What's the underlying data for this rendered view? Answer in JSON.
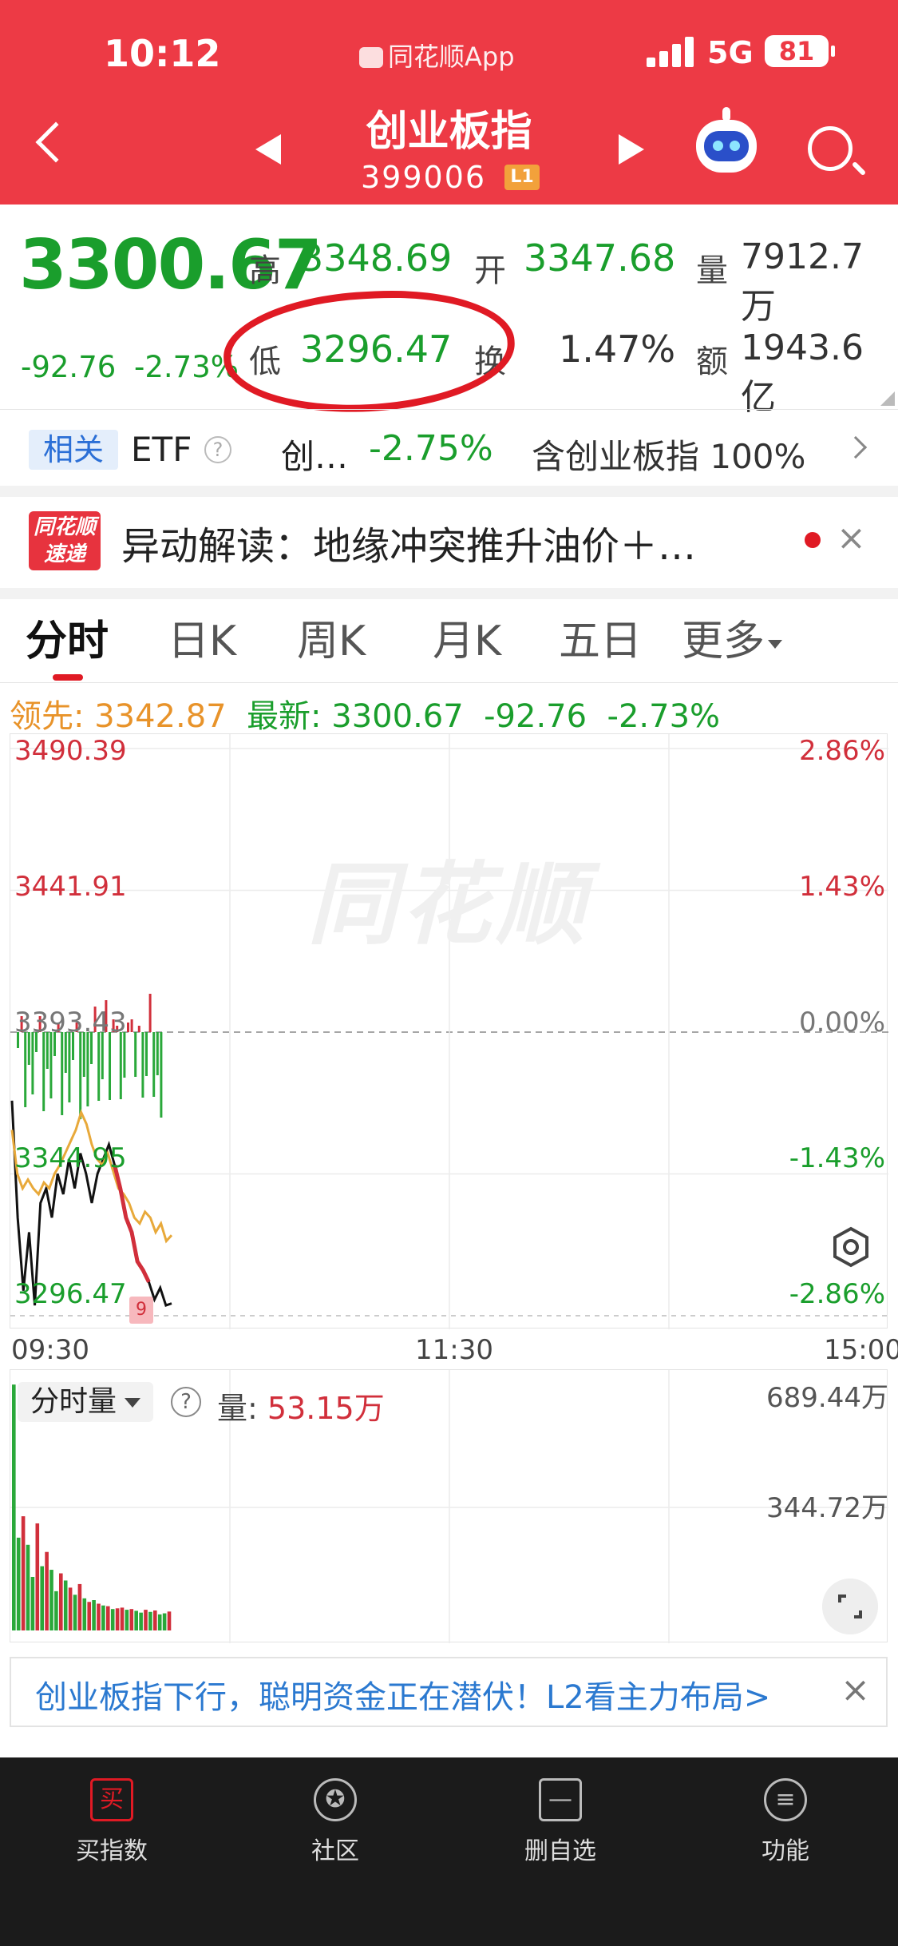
{
  "status_bar": {
    "time": "10:12",
    "app": "同花顺App",
    "network": "5G",
    "battery": "81"
  },
  "nav": {
    "title": "创业板指",
    "code": "399006",
    "level": "L1"
  },
  "quote": {
    "price": "3300.67",
    "change": "-92.76",
    "change_pct": "-2.73%",
    "high_label": "高",
    "high": "3348.69",
    "open_label": "开",
    "open": "3347.68",
    "volume_label": "量",
    "volume": "7912.7万",
    "low_label": "低",
    "low": "3296.47",
    "turnover_label": "换",
    "turnover": "1.47%",
    "amount_label": "额",
    "amount": "1943.6亿"
  },
  "related": {
    "tag": "相关",
    "etf_label": "ETF",
    "etf_name": "创…",
    "etf_change": "-2.75%",
    "holding": "含创业板指 100%"
  },
  "news": {
    "logo_top": "同花顺",
    "logo_bottom": "速递",
    "text": "异动解读：地缘冲突推升油价＋…"
  },
  "tabs": [
    "分时",
    "日K",
    "周K",
    "月K",
    "五日",
    "更多"
  ],
  "lead_row": {
    "lead_label": "领先:",
    "lead_value": "3342.87",
    "latest_label": "最新:",
    "latest_value": "3300.67",
    "change": "-92.76",
    "change_pct": "-2.73%"
  },
  "watermark": "同花顺",
  "chart_data": {
    "type": "line",
    "title": "",
    "y_labels_left": [
      "3490.39",
      "3441.91",
      "3393.43",
      "3344.95",
      "3296.47"
    ],
    "y_labels_right": [
      "2.86%",
      "1.43%",
      "0.00%",
      "-1.43%",
      "-2.86%"
    ],
    "x_labels": [
      "09:30",
      "11:30",
      "15:00"
    ],
    "ylim": [
      3296.47,
      3490.39
    ],
    "prev_close": 3393.43,
    "series": [
      {
        "values": [
          3370,
          3330,
          3305,
          3325,
          3300,
          3335,
          3340,
          3330,
          3345,
          3338,
          3350,
          3340,
          3352,
          3345,
          3335,
          3345,
          3350,
          3355,
          3348,
          3340,
          3330,
          3325,
          3315,
          3312,
          3308,
          3302,
          3306,
          3300,
          3300.67
        ]
      },
      {
        "values": [
          3360,
          3345,
          3340,
          3343,
          3340,
          3338,
          3342,
          3340,
          3345,
          3348,
          3352,
          3356,
          3360,
          3366,
          3362,
          3355,
          3350,
          3348,
          3352,
          3346,
          3340,
          3338,
          3335,
          3330,
          3328,
          3332,
          3330,
          3325,
          3328,
          3322,
          3324
        ]
      }
    ],
    "marker": "9"
  },
  "volume": {
    "selector": "分时量",
    "label": "量:",
    "value": "53.15万",
    "y_labels": [
      "689.44万",
      "344.72万"
    ],
    "ymax": 689.44,
    "bars": [
      689,
      260,
      320,
      240,
      150,
      300,
      180,
      220,
      170,
      110,
      160,
      140,
      120,
      100,
      130,
      90,
      80,
      85,
      75,
      70,
      68,
      60,
      62,
      64,
      58,
      60,
      55,
      50,
      58,
      52,
      56,
      45,
      48,
      53
    ],
    "bar_colors": [
      "g",
      "g",
      "r",
      "g",
      "g",
      "r",
      "g",
      "r",
      "g",
      "g",
      "r",
      "g",
      "r",
      "g",
      "r",
      "g",
      "r",
      "g",
      "r",
      "g",
      "r",
      "g",
      "r",
      "r",
      "g",
      "r",
      "g",
      "g",
      "r",
      "g",
      "r",
      "g",
      "g",
      "r"
    ]
  },
  "banner": {
    "text": "创业板指下行，聪明资金正在潜伏！L2看主力布局>"
  },
  "bottom_nav": [
    {
      "icon": "买",
      "label": "买指数"
    },
    {
      "icon": "✪",
      "label": "社区"
    },
    {
      "icon": "—",
      "label": "删自选"
    },
    {
      "icon": "≡",
      "label": "功能"
    }
  ],
  "colors": {
    "header": "#ed3a45",
    "up": "#d12f3b",
    "down": "#1a9e2c",
    "lead": "#e8932a"
  }
}
